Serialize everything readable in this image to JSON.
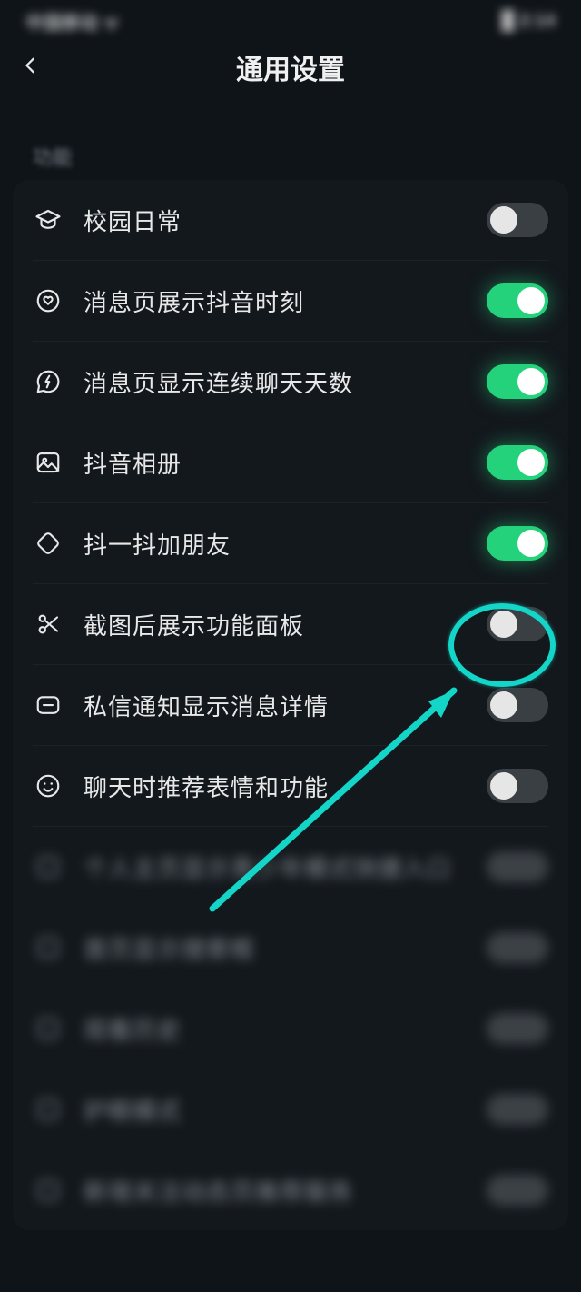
{
  "statusbar": {
    "left": "中国移动 ᯤ",
    "right": "█ 2:14"
  },
  "header": {
    "title": "通用设置"
  },
  "section_label": "功能",
  "items": [
    {
      "icon": "graduation-cap-icon",
      "label": "校园日常",
      "on": false
    },
    {
      "icon": "target-heart-icon",
      "label": "消息页展示抖音时刻",
      "on": true
    },
    {
      "icon": "bolt-bubble-icon",
      "label": "消息页显示连续聊天天数",
      "on": true
    },
    {
      "icon": "photo-icon",
      "label": "抖音相册",
      "on": true
    },
    {
      "icon": "rotate-square-icon",
      "label": "抖一抖加朋友",
      "on": true
    },
    {
      "icon": "scissors-icon",
      "label": "截图后展示功能面板",
      "on": false
    },
    {
      "icon": "message-minus-icon",
      "label": "私信通知显示消息详情",
      "on": false
    },
    {
      "icon": "face-smile-icon",
      "label": "聊天时推荐表情和功能",
      "on": false
    }
  ],
  "blurred_items": [
    {
      "label": "个人主页显示青少年模式快捷入口"
    },
    {
      "label": "首页显示搜索框"
    },
    {
      "label": "观看历史"
    },
    {
      "label": "护眼模式"
    },
    {
      "label": "新增关注动态页推荐服务"
    }
  ]
}
